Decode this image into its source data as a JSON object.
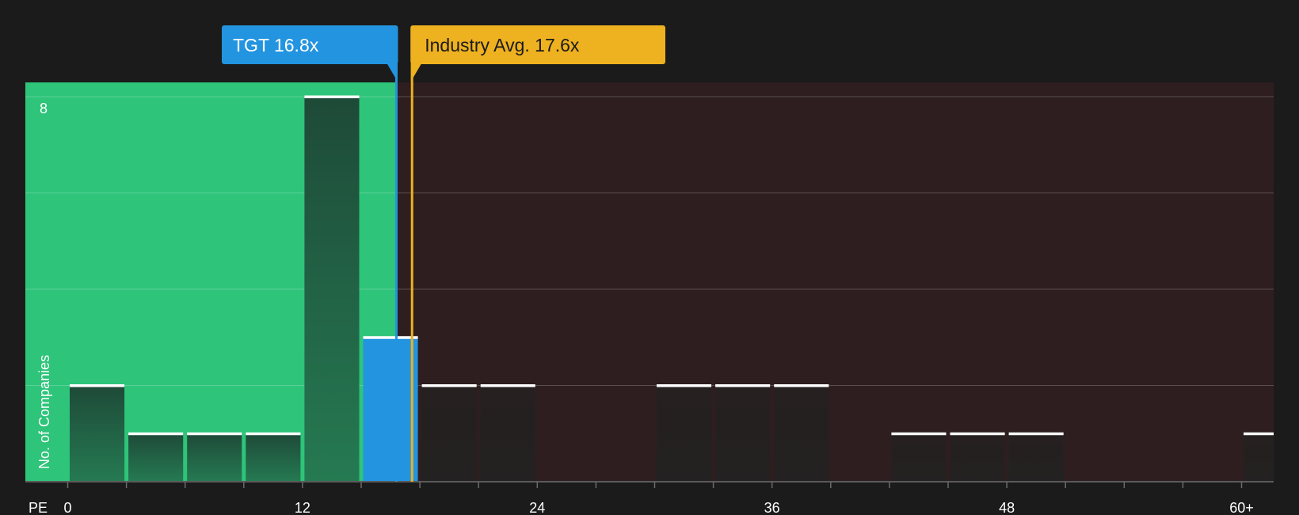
{
  "chart_data": {
    "type": "bar",
    "x_axis_title": "PE",
    "y_axis_title": "No. of Companies",
    "x_ticks": [
      0,
      12,
      24,
      36,
      48
    ],
    "x_tick_labels": [
      "0",
      "12",
      "24",
      "36",
      "48",
      "60+"
    ],
    "x_max_label": "60+",
    "y_tick_label": "8",
    "ylim": [
      0,
      8
    ],
    "x_range": [
      -2.2,
      61.5
    ],
    "bin_width": 3,
    "bins": [
      {
        "start": 0,
        "count": 2
      },
      {
        "start": 3,
        "count": 1
      },
      {
        "start": 6,
        "count": 1
      },
      {
        "start": 9,
        "count": 1
      },
      {
        "start": 12,
        "count": 8
      },
      {
        "start": 15,
        "count": 3,
        "highlight": true
      },
      {
        "start": 18,
        "count": 2
      },
      {
        "start": 21,
        "count": 2
      },
      {
        "start": 24,
        "count": 0
      },
      {
        "start": 27,
        "count": 0
      },
      {
        "start": 30,
        "count": 2
      },
      {
        "start": 33,
        "count": 2
      },
      {
        "start": 36,
        "count": 2
      },
      {
        "start": 39,
        "count": 0
      },
      {
        "start": 42,
        "count": 1
      },
      {
        "start": 45,
        "count": 1
      },
      {
        "start": 48,
        "count": 1
      },
      {
        "start": 51,
        "count": 0
      },
      {
        "start": 54,
        "count": 0
      },
      {
        "start": 57,
        "count": 0
      },
      {
        "start": 60,
        "count": 1
      }
    ],
    "company": {
      "ticker": "TGT",
      "value": 16.8,
      "label": "16.8x",
      "color": "#2394e0"
    },
    "industry": {
      "label": "Industry Avg.",
      "value": 17.6,
      "value_label": "17.6x",
      "color": "#eeb11f"
    },
    "zones": {
      "undervalued_color": "#2ec47a",
      "overvalued_color": "#2e1e1f"
    },
    "grid": true,
    "legend": "none"
  }
}
